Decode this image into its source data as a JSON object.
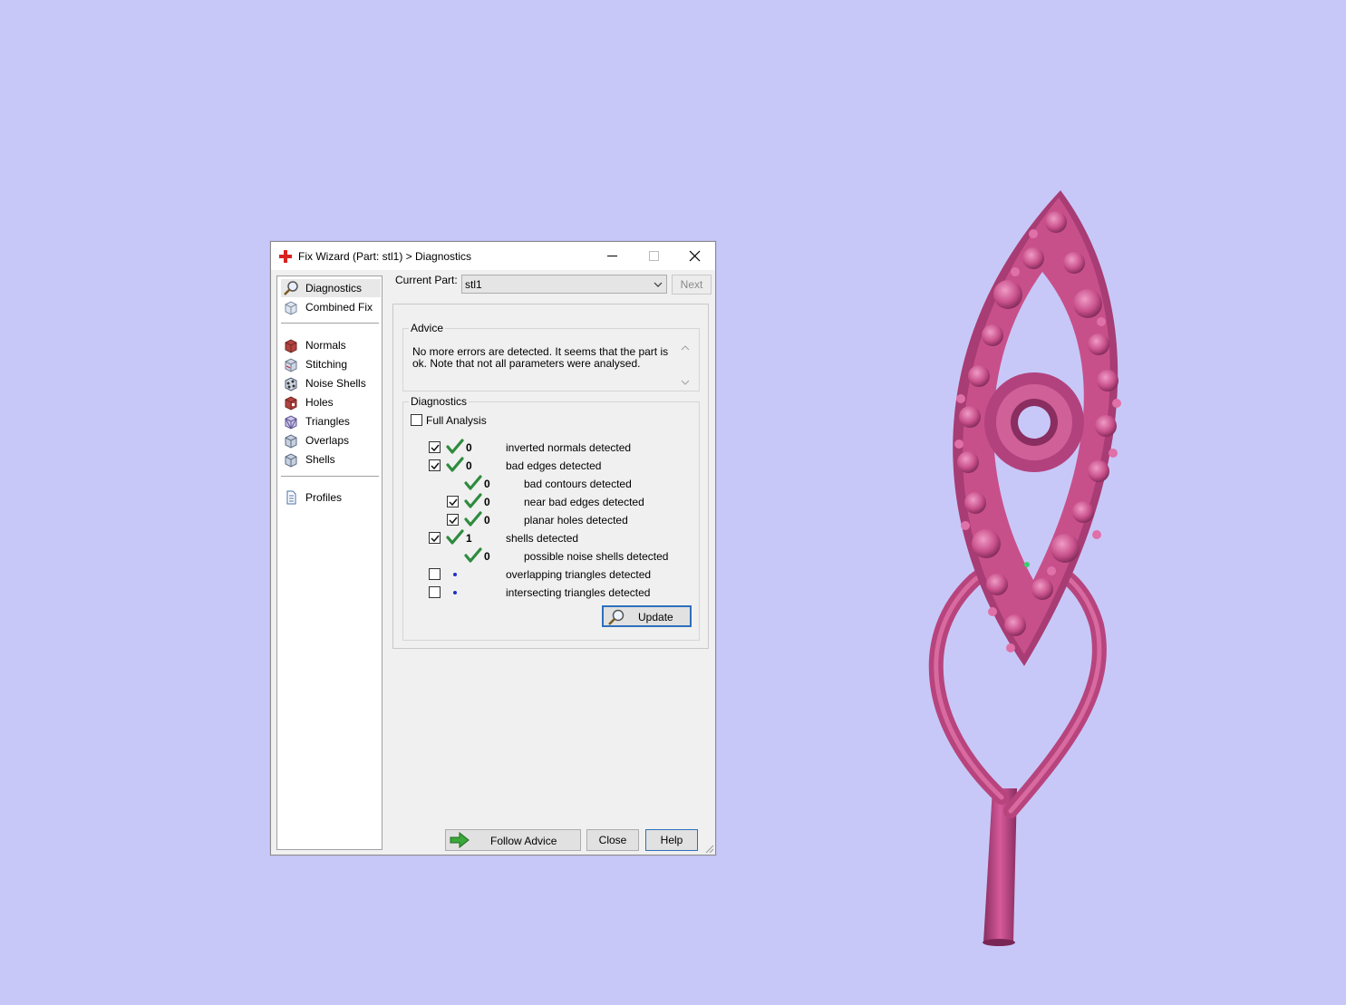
{
  "window": {
    "title": "Fix Wizard (Part: stl1) > Diagnostics",
    "icons": {
      "app": "red-cross-icon",
      "minimize": "minimize-icon",
      "maximize": "maximize-icon",
      "close": "close-icon"
    }
  },
  "sidebar": {
    "top_items": [
      {
        "label": "Diagnostics",
        "icon": "magnifier-icon",
        "selected": true
      },
      {
        "label": "Combined Fix",
        "icon": "cube-icon"
      }
    ],
    "fix_items": [
      {
        "label": "Normals",
        "icon": "normals-cube-icon"
      },
      {
        "label": "Stitching",
        "icon": "stitching-cube-icon"
      },
      {
        "label": "Noise Shells",
        "icon": "noise-shells-icon"
      },
      {
        "label": "Holes",
        "icon": "holes-cube-icon"
      },
      {
        "label": "Triangles",
        "icon": "triangles-cube-icon"
      },
      {
        "label": "Overlaps",
        "icon": "overlaps-cube-icon"
      },
      {
        "label": "Shells",
        "icon": "shells-cube-icon"
      }
    ],
    "bottom_items": [
      {
        "label": "Profiles",
        "icon": "document-icon"
      }
    ]
  },
  "current_part": {
    "label": "Current Part:",
    "value": "stl1"
  },
  "next_button": "Next",
  "advice": {
    "title": "Advice",
    "text": "No more errors are detected. It seems that the part is ok. Note that not all parameters were analysed."
  },
  "diagnostics": {
    "title": "Diagnostics",
    "full_analysis_label": "Full Analysis",
    "full_analysis_checked": false,
    "rows": [
      {
        "label": "inverted normals detected",
        "count": "0",
        "checkbox": true,
        "checked": true,
        "status": "ok"
      },
      {
        "label": "bad edges detected",
        "count": "0",
        "checkbox": true,
        "checked": true,
        "status": "ok"
      },
      {
        "label": "bad contours detected",
        "count": "0",
        "checkbox": false,
        "status": "ok"
      },
      {
        "label": "near bad edges detected",
        "count": "0",
        "checkbox": true,
        "checked": true,
        "status": "ok"
      },
      {
        "label": "planar holes detected",
        "count": "0",
        "checkbox": true,
        "checked": true,
        "status": "ok"
      },
      {
        "label": "shells detected",
        "count": "1",
        "checkbox": true,
        "checked": true,
        "status": "ok"
      },
      {
        "label": "possible noise shells detected",
        "count": "0",
        "checkbox": false,
        "status": "ok"
      },
      {
        "label": "overlapping triangles detected",
        "count": "",
        "checkbox": true,
        "checked": false,
        "status": "pending"
      },
      {
        "label": "intersecting triangles detected",
        "count": "",
        "checkbox": true,
        "checked": false,
        "status": "pending"
      }
    ],
    "update_button": "Update"
  },
  "footer": {
    "follow_advice": "Follow Advice",
    "close": "Close",
    "help": "Help"
  },
  "colors": {
    "viewport_bg": "#c8c8f8",
    "model": "#c0508a",
    "check_green": "#2e8b3e",
    "pending_dot": "#1f2fc8"
  }
}
